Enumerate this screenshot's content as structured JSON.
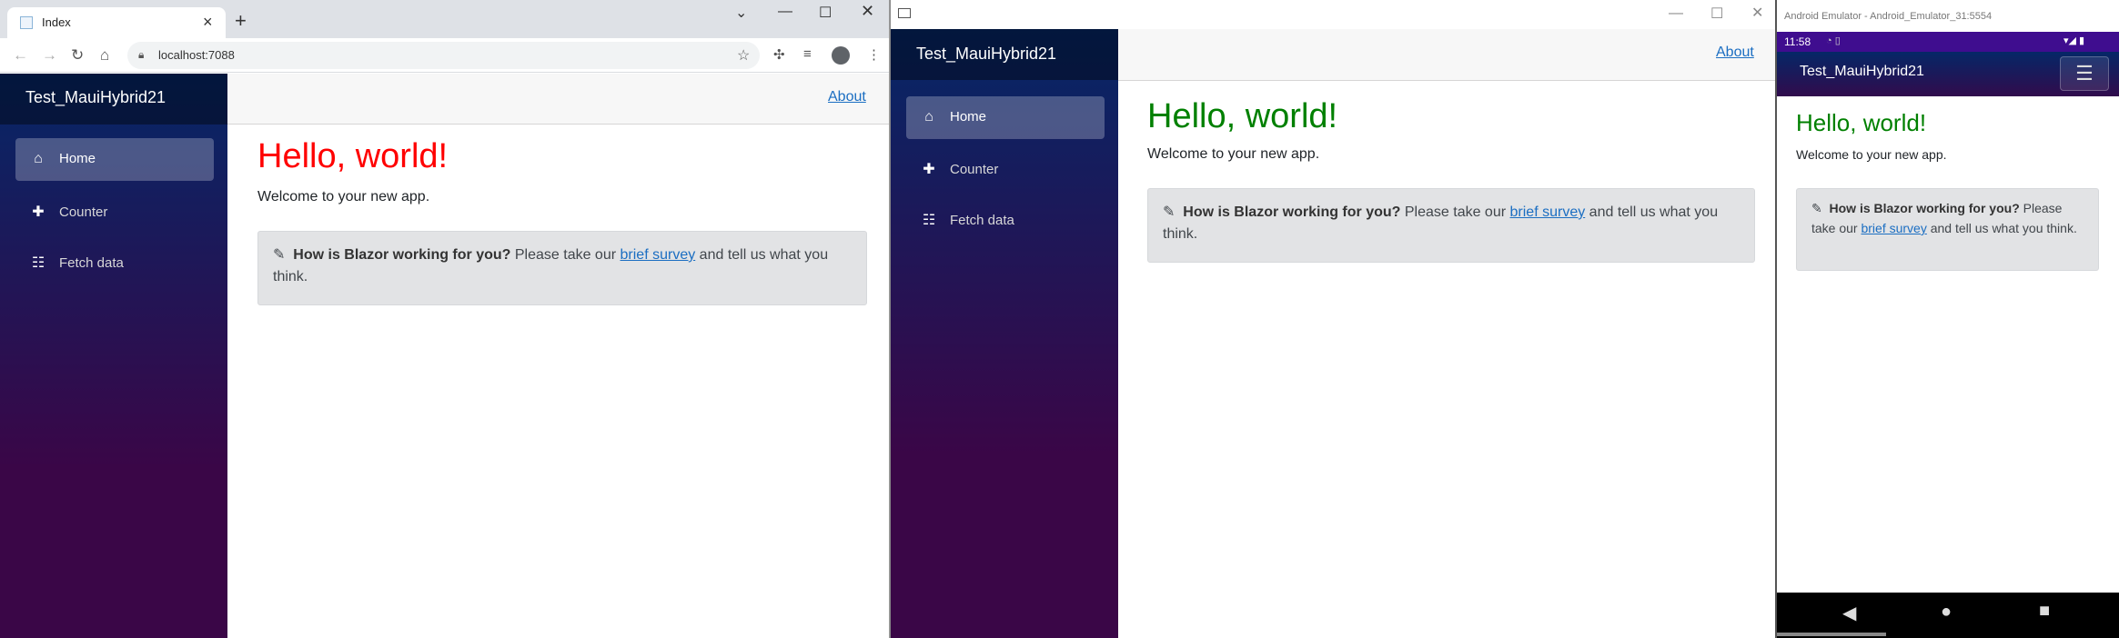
{
  "chrome": {
    "tab_title": "Index",
    "url": "localhost:7088"
  },
  "app": {
    "brand": "Test_MauiHybrid21",
    "nav": [
      {
        "label": "Home",
        "icon": "home-icon"
      },
      {
        "label": "Counter",
        "icon": "plus-icon"
      },
      {
        "label": "Fetch data",
        "icon": "list-icon"
      }
    ],
    "about_link": "About",
    "heading": "Hello, world!",
    "welcome": "Welcome to your new app.",
    "survey": {
      "question": "How is Blazor working for you?",
      "prefix": "Please take our",
      "link": "brief survey",
      "suffix": "and tell us what you think."
    }
  },
  "colors": {
    "chrome_heading": "#ff0000",
    "maui_heading": "#008000",
    "sidebar_top": "#052767",
    "sidebar_bottom": "#3a0647",
    "link": "#1b6ec2"
  },
  "emulator": {
    "window_title": "Android Emulator - Android_Emulator_31:5554",
    "clock": "11:58"
  }
}
